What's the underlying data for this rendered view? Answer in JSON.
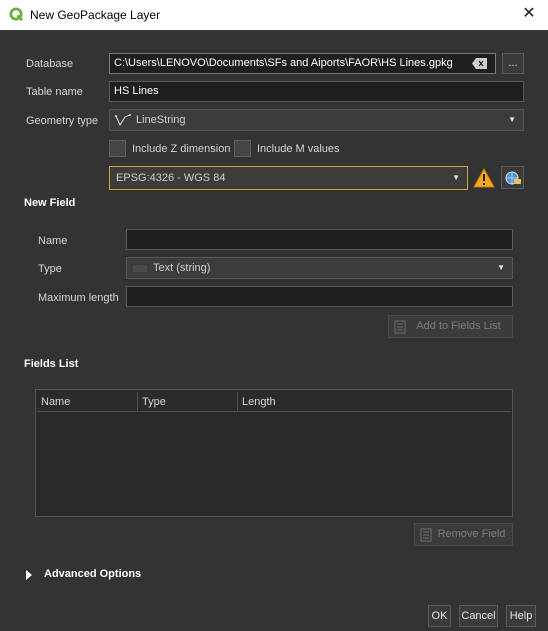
{
  "window": {
    "title": "New GeoPackage Layer"
  },
  "database": {
    "label": "Database",
    "value": "C:\\Users\\LENOVO\\Documents\\SFs and Aiports\\FAOR\\HS Lines.gpkg",
    "browse_label": "..."
  },
  "table_name": {
    "label": "Table name",
    "value": "HS Lines"
  },
  "geometry_type": {
    "label": "Geometry type",
    "value": "LineString"
  },
  "include_z": {
    "label": "Include Z dimension"
  },
  "include_m": {
    "label": "Include M values"
  },
  "crs": {
    "value": "EPSG:4326 - WGS 84"
  },
  "new_field": {
    "heading": "New Field",
    "name_label": "Name",
    "name_value": "",
    "type_label": "Type",
    "type_value": "Text (string)",
    "max_length_label": "Maximum length",
    "max_length_value": "",
    "add_button": "Add to Fields List"
  },
  "fields_list": {
    "heading": "Fields List",
    "columns": [
      "Name",
      "Type",
      "Length"
    ],
    "remove_button": "Remove Field"
  },
  "advanced_options": {
    "label": "Advanced Options"
  },
  "buttons": {
    "ok": "OK",
    "cancel": "Cancel",
    "help": "Help"
  },
  "colors": {
    "background": "#333333",
    "titlebar": "#ffffff",
    "warning": "#f5a623",
    "qgis_green": "#6bb23b"
  }
}
